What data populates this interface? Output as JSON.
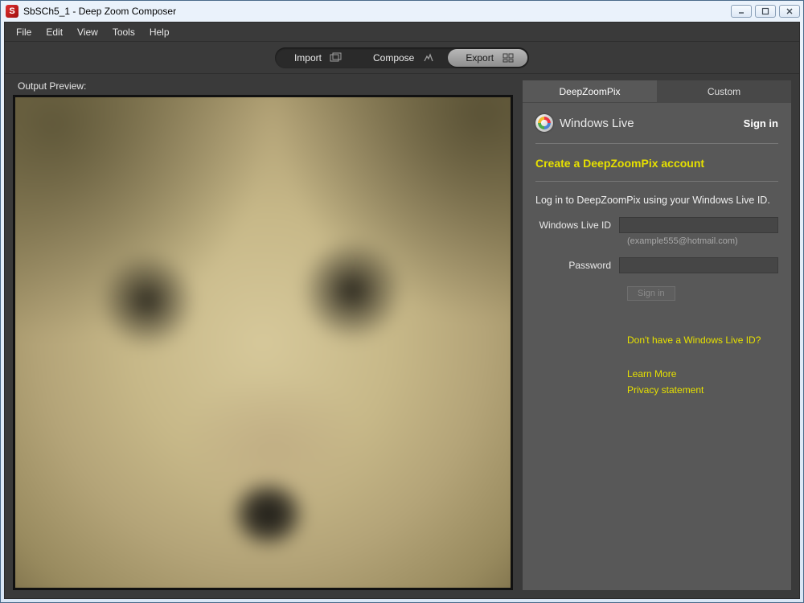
{
  "window": {
    "title": "SbSCh5_1 - Deep Zoom Composer"
  },
  "menu": {
    "items": [
      "File",
      "Edit",
      "View",
      "Tools",
      "Help"
    ]
  },
  "modes": {
    "import": "Import",
    "compose": "Compose",
    "export": "Export"
  },
  "preview": {
    "label": "Output Preview:"
  },
  "side": {
    "tabs": {
      "deepzoompix": "DeepZoomPix",
      "custom": "Custom"
    },
    "brand": "Windows Live",
    "signin_header": "Sign in",
    "create_account": "Create a DeepZoomPix account",
    "login_intro": "Log in to DeepZoomPix using your Windows Live ID.",
    "form": {
      "id_label": "Windows Live ID",
      "id_hint": "(example555@hotmail.com)",
      "pw_label": "Password",
      "signin_button": "Sign in"
    },
    "links": {
      "no_id": "Don't have a Windows Live ID?",
      "learn_more": "Learn More",
      "privacy": "Privacy statement"
    }
  }
}
